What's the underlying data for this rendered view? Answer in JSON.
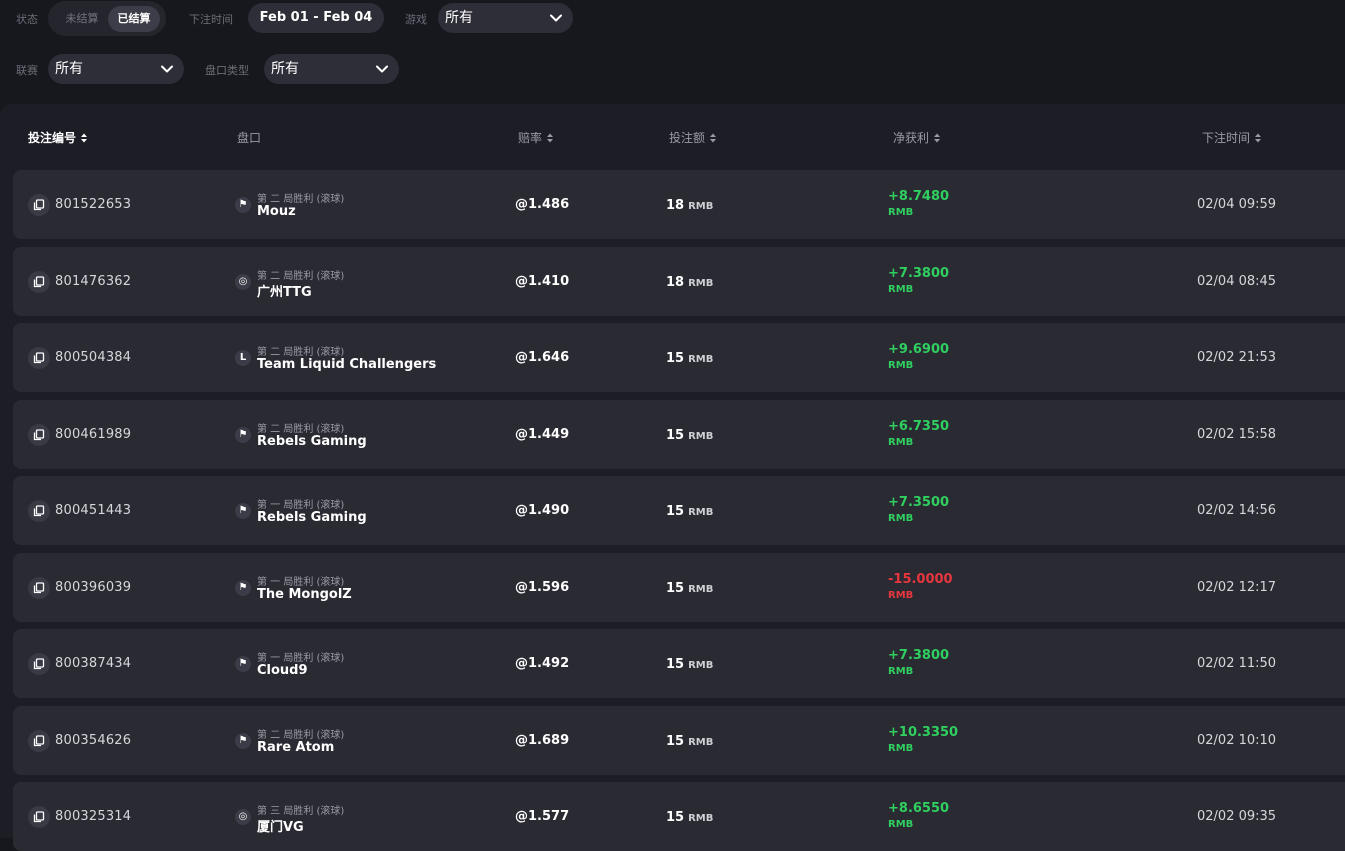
{
  "filters": {
    "status_label": "状态",
    "status_unsettled": "未结算",
    "status_settled": "已结算",
    "bet_time_label": "下注时间",
    "date_range": "Feb 01 - Feb 04",
    "game_label": "游戏",
    "game_value": "所有",
    "league_label": "联赛",
    "league_value": "所有",
    "market_type_label": "盘口类型",
    "market_type_value": "所有"
  },
  "table": {
    "headers": {
      "bet_id": "投注编号",
      "market": "盘口",
      "odds": "赔率",
      "stake": "投注额",
      "net_profit": "净获利",
      "bet_time": "下注时间"
    },
    "rows": [
      {
        "bet_id": "801522653",
        "game_icon": "cs-icon",
        "market_type": "第 二 局胜利 (滚球)",
        "team": "Mouz",
        "odds": "@1.486",
        "stake": "18",
        "currency": "RMB",
        "profit": "+8.7480",
        "profit_currency": "RMB",
        "result": "win",
        "time": "02/04 09:59"
      },
      {
        "bet_id": "801476362",
        "game_icon": "dota-icon",
        "market_type": "第 二 局胜利 (滚球)",
        "team": "广州TTG",
        "odds": "@1.410",
        "stake": "18",
        "currency": "RMB",
        "profit": "+7.3800",
        "profit_currency": "RMB",
        "result": "win",
        "time": "02/04 08:45"
      },
      {
        "bet_id": "800504384",
        "game_icon": "lol-icon",
        "market_type": "第 二 局胜利 (滚球)",
        "team": "Team Liquid Challengers",
        "odds": "@1.646",
        "stake": "15",
        "currency": "RMB",
        "profit": "+9.6900",
        "profit_currency": "RMB",
        "result": "win",
        "time": "02/02 21:53"
      },
      {
        "bet_id": "800461989",
        "game_icon": "cs-icon",
        "market_type": "第 二 局胜利 (滚球)",
        "team": "Rebels Gaming",
        "odds": "@1.449",
        "stake": "15",
        "currency": "RMB",
        "profit": "+6.7350",
        "profit_currency": "RMB",
        "result": "win",
        "time": "02/02 15:58"
      },
      {
        "bet_id": "800451443",
        "game_icon": "cs-icon",
        "market_type": "第 一 局胜利 (滚球)",
        "team": "Rebels Gaming",
        "odds": "@1.490",
        "stake": "15",
        "currency": "RMB",
        "profit": "+7.3500",
        "profit_currency": "RMB",
        "result": "win",
        "time": "02/02 14:56"
      },
      {
        "bet_id": "800396039",
        "game_icon": "cs-icon",
        "market_type": "第 一 局胜利 (滚球)",
        "team": "The MongolZ",
        "odds": "@1.596",
        "stake": "15",
        "currency": "RMB",
        "profit": "-15.0000",
        "profit_currency": "RMB",
        "result": "loss",
        "time": "02/02 12:17"
      },
      {
        "bet_id": "800387434",
        "game_icon": "cs-icon",
        "market_type": "第 一 局胜利 (滚球)",
        "team": "Cloud9",
        "odds": "@1.492",
        "stake": "15",
        "currency": "RMB",
        "profit": "+7.3800",
        "profit_currency": "RMB",
        "result": "win",
        "time": "02/02 11:50"
      },
      {
        "bet_id": "800354626",
        "game_icon": "cs-icon",
        "market_type": "第 二 局胜利 (滚球)",
        "team": "Rare Atom",
        "odds": "@1.689",
        "stake": "15",
        "currency": "RMB",
        "profit": "+10.3350",
        "profit_currency": "RMB",
        "result": "win",
        "time": "02/02 10:10"
      },
      {
        "bet_id": "800325314",
        "game_icon": "dota-icon",
        "market_type": "第 三 局胜利 (滚球)",
        "team": "厦门VG",
        "odds": "@1.577",
        "stake": "15",
        "currency": "RMB",
        "profit": "+8.6550",
        "profit_currency": "RMB",
        "result": "win",
        "time": "02/02 09:35"
      }
    ]
  },
  "colors": {
    "win": "#2fd05f",
    "loss": "#e8363e",
    "background": "#17171e",
    "row": "#2a2a33"
  }
}
